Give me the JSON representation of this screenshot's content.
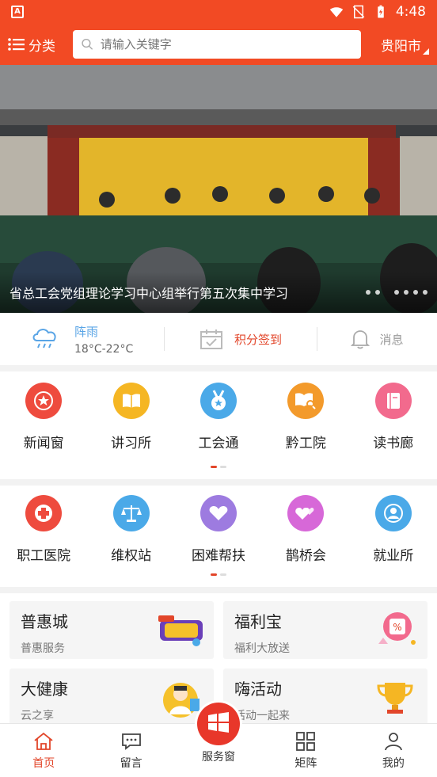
{
  "status_bar": {
    "app_badge": "A",
    "time": "4:48"
  },
  "header": {
    "category_label": "分类",
    "search_placeholder": "请输入关键字",
    "city": "贵阳市"
  },
  "banner": {
    "caption": "省总工会党组理论学习中心组举行第五次集中学习",
    "slide_count": 6
  },
  "info": {
    "weather_condition": "阵雨",
    "weather_temp": "18°C-22°C",
    "checkin_label": "积分签到",
    "messages_label": "消息"
  },
  "grid_one": {
    "items": [
      {
        "label": "新闻窗",
        "icon": "star-badge-icon",
        "color": "#ee4b3e"
      },
      {
        "label": "讲习所",
        "icon": "open-book-icon",
        "color": "#f5b623"
      },
      {
        "label": "工会通",
        "icon": "medal-icon",
        "color": "#4aa9e8"
      },
      {
        "label": "黔工院",
        "icon": "book-search-icon",
        "color": "#f39a2b"
      },
      {
        "label": "读书廊",
        "icon": "book-icon",
        "color": "#f26a8d"
      }
    ]
  },
  "grid_two": {
    "items": [
      {
        "label": "职工医院",
        "icon": "medical-cross-icon",
        "color": "#ee4b3e"
      },
      {
        "label": "维权站",
        "icon": "scales-icon",
        "color": "#4aa9e8"
      },
      {
        "label": "困难帮扶",
        "icon": "heart-hands-icon",
        "color": "#9d7be0"
      },
      {
        "label": "鹊桥会",
        "icon": "hearts-icon",
        "color": "#d768d8"
      },
      {
        "label": "就业所",
        "icon": "person-icon",
        "color": "#4aa9e8"
      }
    ]
  },
  "features": [
    {
      "title": "普惠城",
      "subtitle": "普惠服务",
      "icon": "promo-banner-icon"
    },
    {
      "title": "福利宝",
      "subtitle": "福利大放送",
      "icon": "discount-ticket-icon"
    },
    {
      "title": "大健康",
      "subtitle": "云之享",
      "icon": "doctor-icon"
    },
    {
      "title": "嗨活动",
      "subtitle": "活动一起来",
      "icon": "trophy-icon"
    }
  ],
  "bottom_nav": {
    "home": "首页",
    "message": "留言",
    "service": "服务窗",
    "matrix": "矩阵",
    "mine": "我的"
  },
  "colors": {
    "brand": "#f24a24",
    "accent": "#e2462a",
    "weather": "#5aa5e6"
  }
}
